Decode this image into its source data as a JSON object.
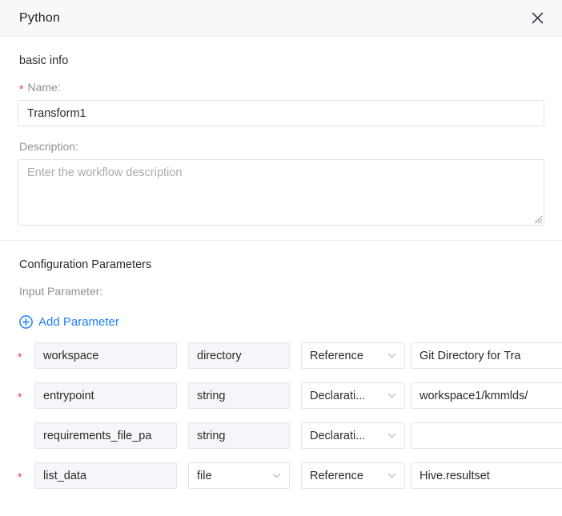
{
  "header": {
    "title": "Python",
    "close_icon": "close-icon"
  },
  "basic_info": {
    "section_title": "basic info",
    "name": {
      "label": "Name:",
      "required": true,
      "value": "Transform1"
    },
    "description": {
      "label": "Description:",
      "required": false,
      "value": "",
      "placeholder": "Enter the workflow description"
    }
  },
  "config": {
    "section_title": "Configuration Parameters",
    "input_parameter_label": "Input Parameter:",
    "add_parameter_label": "Add Parameter",
    "add_parameter_icon": "plus-circle-icon",
    "rows": [
      {
        "required": "*",
        "name": "workspace",
        "type": "directory",
        "type_has_chevron": false,
        "mode": "Reference",
        "mode_has_chevron": true,
        "value": "Git Directory for Tra"
      },
      {
        "required": "*",
        "name": "entrypoint",
        "type": "string",
        "type_has_chevron": false,
        "mode": "Declarati...",
        "mode_has_chevron": true,
        "value": "workspace1/kmmlds/"
      },
      {
        "required": "",
        "name": "requirements_file_pa",
        "type": "string",
        "type_has_chevron": false,
        "mode": "Declarati...",
        "mode_has_chevron": true,
        "value": ""
      },
      {
        "required": "*",
        "name": "list_data",
        "type": "file",
        "type_has_chevron": true,
        "mode": "Reference",
        "mode_has_chevron": true,
        "value": "Hive.resultset"
      }
    ]
  },
  "colors": {
    "accent": "#1f7ff5",
    "required": "#e8333a",
    "header_bg": "#f7f8fa",
    "readonly_bg": "#f6f6fa",
    "border": "#e3e5e9",
    "label": "#8f9197"
  }
}
